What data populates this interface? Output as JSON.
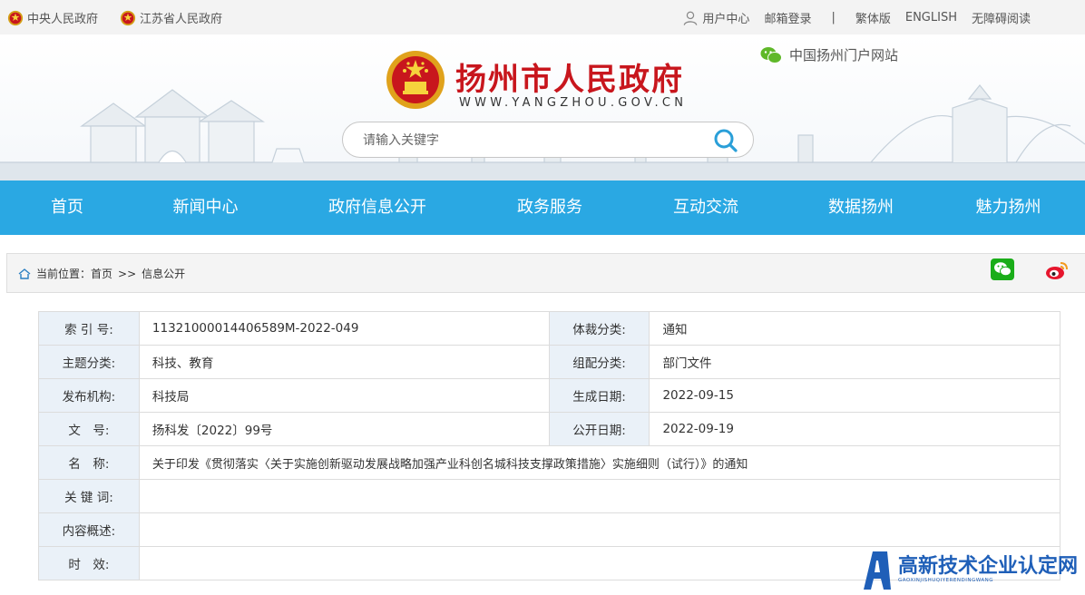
{
  "topbar": {
    "central_gov": "中央人民政府",
    "province_gov": "江苏省人民政府",
    "user_center": "用户中心",
    "mail_login": "邮箱登录",
    "separator": "|",
    "traditional": "繁体版",
    "english": "ENGLISH",
    "accessible": "无障碍阅读"
  },
  "header": {
    "title": "扬州市人民政府",
    "url": "WWW.YANGZHOU.GOV.CN",
    "portal_link": "中国扬州门户网站"
  },
  "search": {
    "placeholder": "请输入关键字"
  },
  "nav": {
    "items": [
      {
        "label": "首页"
      },
      {
        "label": "新闻中心"
      },
      {
        "label": "政府信息公开"
      },
      {
        "label": "政务服务"
      },
      {
        "label": "互动交流"
      },
      {
        "label": "数据扬州"
      },
      {
        "label": "魅力扬州"
      }
    ]
  },
  "breadcrumb": {
    "prefix": "当前位置：",
    "home": "首页",
    "sep": ">>",
    "current": "信息公开"
  },
  "info": {
    "index_label": "索 引 号:",
    "index_value": "11321000014406589M-2022-049",
    "genre_label": "体裁分类:",
    "genre_value": "通知",
    "topic_label": "主题分类:",
    "topic_value": "科技、教育",
    "group_label": "组配分类:",
    "group_value": "部门文件",
    "org_label": "发布机构:",
    "org_value": "科技局",
    "date_label": "生成日期:",
    "date_value": "2022-09-15",
    "docno_label": "文　号:",
    "docno_value": "扬科发〔2022〕99号",
    "pubdate_label": "公开日期:",
    "pubdate_value": "2022-09-19",
    "name_label": "名　称:",
    "name_value": "关于印发《贯彻落实〈关于实施创新驱动发展战略加强产业科创名城科技支撑政策措施〉实施细则（试行）》的通知",
    "keyword_label": "关 键 词:",
    "keyword_value": "",
    "summary_label": "内容概述:",
    "summary_value": "",
    "validity_label": "时　效:",
    "validity_value": ""
  },
  "watermark": {
    "text": "高新技术企业认定网",
    "sub": "GAOXINJISHUQIYERENDINGWANG"
  },
  "colors": {
    "nav_bg": "#2aa8e3",
    "title_red": "#c8161d",
    "label_bg": "#eaf1f8",
    "watermark_blue": "#1f5fb8"
  }
}
